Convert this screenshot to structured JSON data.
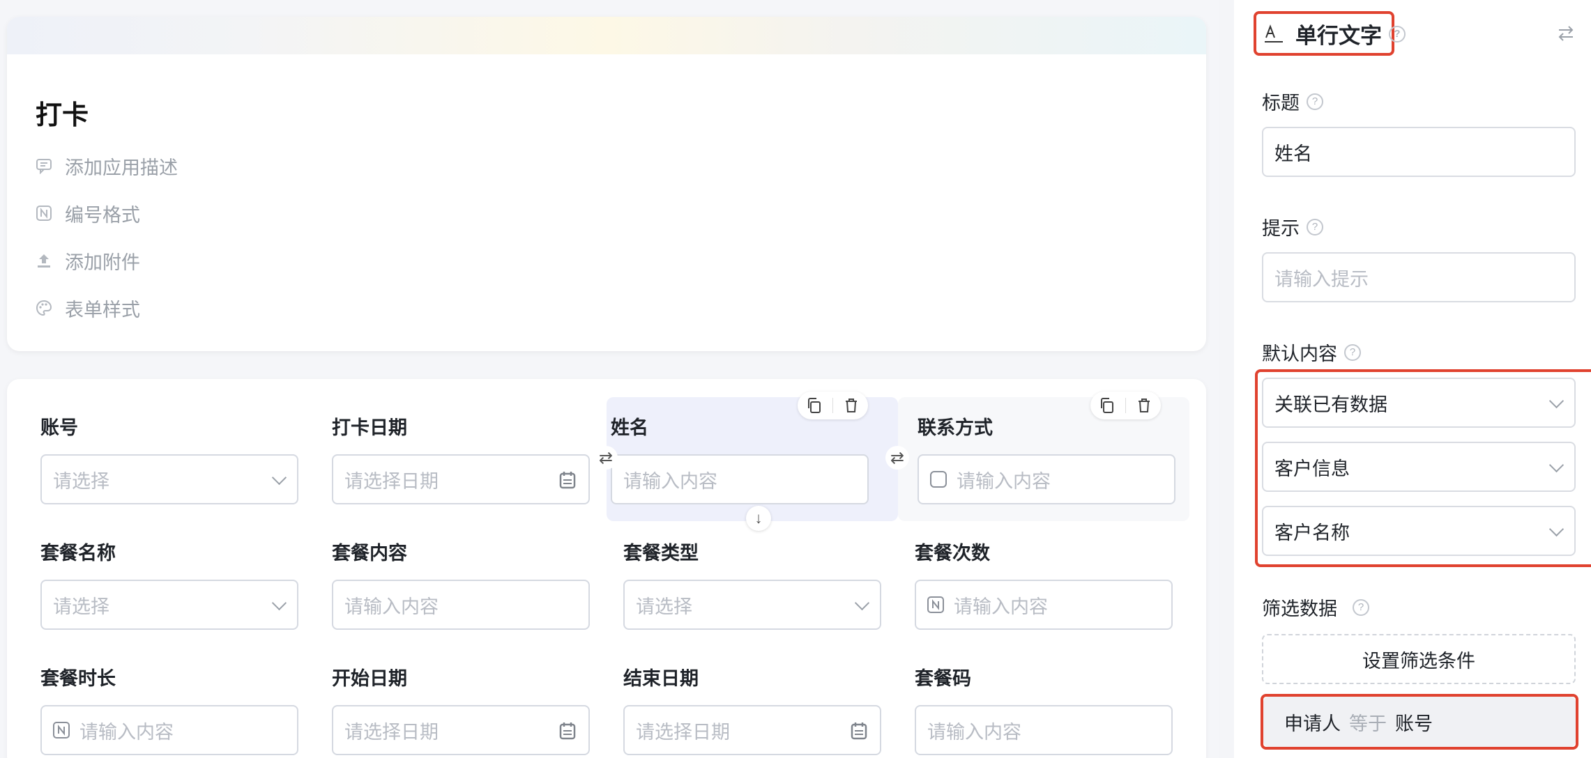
{
  "app": {
    "title": "打卡",
    "meta": [
      "添加应用描述",
      "编号格式",
      "添加附件",
      "表单样式"
    ]
  },
  "form": {
    "fields": [
      {
        "label": "账号",
        "placeholder": "请选择",
        "kind": "select"
      },
      {
        "label": "打卡日期",
        "placeholder": "请选择日期",
        "kind": "date"
      },
      {
        "label": "姓名",
        "placeholder": "请输入内容",
        "kind": "text"
      },
      {
        "label": "联系方式",
        "placeholder": "请输入内容",
        "kind": "phone"
      },
      {
        "label": "套餐名称",
        "placeholder": "请选择",
        "kind": "select"
      },
      {
        "label": "套餐内容",
        "placeholder": "请输入内容",
        "kind": "text"
      },
      {
        "label": "套餐类型",
        "placeholder": "请选择",
        "kind": "select"
      },
      {
        "label": "套餐次数",
        "placeholder": "请输入内容",
        "kind": "number"
      },
      {
        "label": "套餐时长",
        "placeholder": "请输入内容",
        "kind": "number"
      },
      {
        "label": "开始日期",
        "placeholder": "请选择日期",
        "kind": "date"
      },
      {
        "label": "结束日期",
        "placeholder": "请选择日期",
        "kind": "date"
      },
      {
        "label": "套餐码",
        "placeholder": "请输入内容",
        "kind": "text"
      }
    ]
  },
  "panel": {
    "type_title": "单行文字",
    "title_label": "标题",
    "title_value": "姓名",
    "hint_label": "提示",
    "hint_placeholder": "请输入提示",
    "default_label": "默认内容",
    "default_mode": "关联已有数据",
    "default_source": "客户信息",
    "default_field": "客户名称",
    "filter_label": "筛选数据",
    "filter_button": "设置筛选条件",
    "condition": {
      "left": "申请人",
      "op": "等于",
      "right": "账号"
    }
  },
  "colors": {
    "highlight": "#e0422f",
    "selected_bg": "#eef0fb"
  }
}
